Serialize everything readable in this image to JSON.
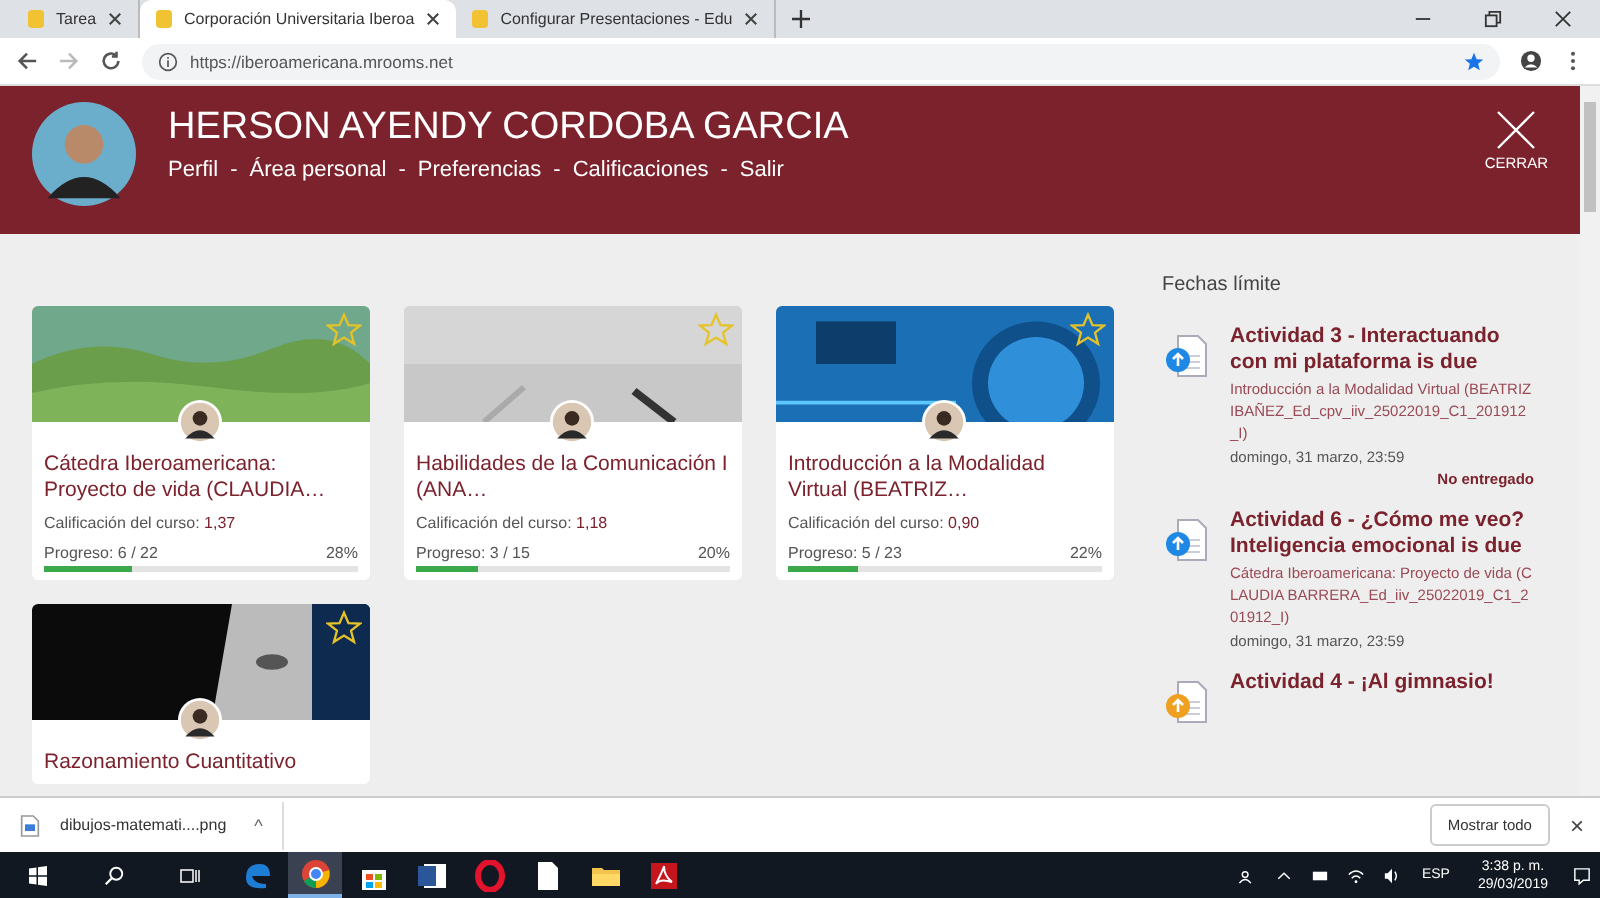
{
  "browser": {
    "tabs": [
      {
        "title": "Tarea",
        "selected": false
      },
      {
        "title": "Corporación Universitaria Iberoa",
        "selected": true
      },
      {
        "title": "Configurar Presentaciones - Edu",
        "selected": false
      }
    ],
    "url": "https://iberoamericana.mrooms.net"
  },
  "header": {
    "name": "HERSON AYENDY CORDOBA GARCIA",
    "separator": "-",
    "links": [
      "Perfil",
      "Área personal",
      "Preferencias",
      "Calificaciones",
      "Salir"
    ],
    "close_label": "CERRAR"
  },
  "courses": [
    {
      "title": "Cátedra Iberoamericana: Proyecto de vida (CLAUDIA…",
      "grade_label": "Calificación del curso:",
      "grade": "1,37",
      "progress": "Progreso: 6 / 22",
      "percent": "28%",
      "level": 0.28
    },
    {
      "title": "Habilidades de la Comunicación I (ANA…",
      "grade_label": "Calificación del curso:",
      "grade": "1,18",
      "progress": "Progreso: 3 / 15",
      "percent": "20%",
      "level": 0.2
    },
    {
      "title": "Introducción a la Modalidad Virtual (BEATRIZ…",
      "grade_label": "Calificación del curso:",
      "grade": "0,90",
      "progress": "Progreso: 5 / 23",
      "percent": "22%",
      "level": 0.22
    },
    {
      "title": "Razonamiento Cuantitativo"
    }
  ],
  "deadlines": {
    "heading": "Fechas límite",
    "items": [
      {
        "title": "Actividad 3 - Interactuando con mi plataforma is due",
        "course": "Introducción a la Modalidad Virtual (BEATRIZ IBAÑEZ_Ed_cpv_iiv_25022019_C1_201912_I)",
        "date": "domingo, 31 marzo, 23:59",
        "status": "No entregado",
        "color": "#1e88e5"
      },
      {
        "title": "Actividad 6 - ¿Cómo me veo? Inteligencia emocional is due",
        "course": "Cátedra Iberoamericana: Proyecto de vida (CLAUDIA BARRERA_Ed_iiv_25022019_C1_201912_I)",
        "date": "domingo, 31 marzo, 23:59",
        "color": "#1e88e5"
      },
      {
        "title": "Actividad 4 - ¡Al gimnasio!",
        "color": "#f0a020"
      }
    ]
  },
  "download": {
    "file": "dibujos-matemati....png",
    "caret": "^",
    "show_all": "Mostrar todo",
    "close": "×"
  },
  "taskbar": {
    "apps": [
      {
        "kind": "edge",
        "selected": false
      },
      {
        "kind": "chrome",
        "selected": true
      },
      {
        "kind": "store",
        "selected": false
      },
      {
        "kind": "word",
        "selected": false
      },
      {
        "kind": "opera",
        "selected": false
      },
      {
        "kind": "file",
        "selected": false
      },
      {
        "kind": "folder",
        "selected": false
      },
      {
        "kind": "pdf",
        "selected": false
      }
    ],
    "lang": "ESP",
    "time": "3:38 p. m.",
    "date": "29/03/2019"
  }
}
